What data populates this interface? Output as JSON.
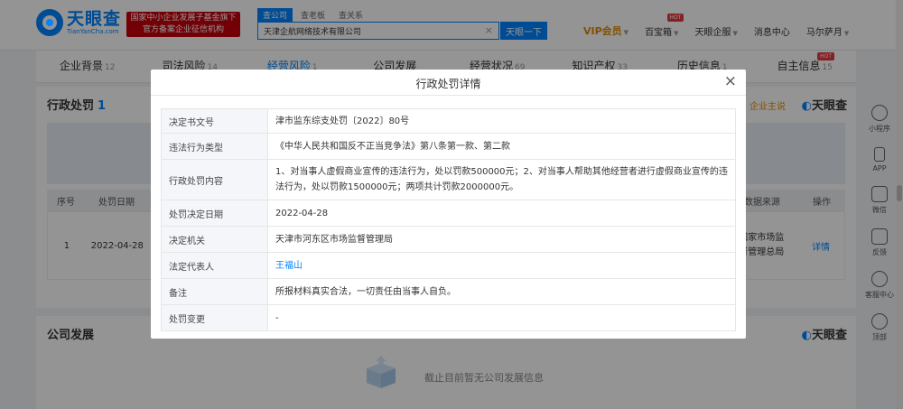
{
  "header": {
    "logo_cn": "天眼查",
    "logo_en": "TianYanCha.com",
    "gov_badge_line1": "国家中小企业发展子基金旗下",
    "gov_badge_line2": "官方备案企业征信机构",
    "search_tabs": [
      "查公司",
      "查老板",
      "查关系"
    ],
    "search_value": "天津企航网络技术有限公司",
    "search_button": "天眼一下",
    "nav": {
      "vip": "VIP会员",
      "treasure": "百宝箱",
      "hot": "HOT",
      "service": "天眼企服",
      "messages": "消息中心",
      "user": "马尔萨月"
    }
  },
  "tabs": [
    {
      "label": "企业背景",
      "count": "12"
    },
    {
      "label": "司法风险",
      "count": "14"
    },
    {
      "label": "经营风险",
      "count": "1"
    },
    {
      "label": "公司发展",
      "count": ""
    },
    {
      "label": "经营状况",
      "count": "69"
    },
    {
      "label": "知识产权",
      "count": "33"
    },
    {
      "label": "历史信息",
      "count": "1"
    },
    {
      "label": "自主信息",
      "count": "15"
    }
  ],
  "section_penalty": {
    "title": "行政处罚",
    "count": "1",
    "link": "企业主说",
    "brand": "天眼查",
    "headers": [
      "序号",
      "处罚日期",
      "数据来源",
      "操作"
    ],
    "row": {
      "index": "1",
      "date": "2022-04-28",
      "source": "国家市场监督管理总局",
      "action": "详情"
    }
  },
  "section_dev": {
    "title": "公司发展",
    "brand": "天眼查",
    "empty": "截止目前暂无公司发展信息"
  },
  "rail": [
    "小程序",
    "APP",
    "微信",
    "反馈",
    "客服中心",
    "顶部"
  ],
  "modal": {
    "title": "行政处罚详情",
    "close": "×",
    "rows": [
      {
        "k": "决定书文号",
        "v": "津市监东综支处罚〔2022〕80号"
      },
      {
        "k": "违法行为类型",
        "v": "《中华人民共和国反不正当竞争法》第八条第一款、第二款"
      },
      {
        "k": "行政处罚内容",
        "v": "1、对当事人虚假商业宣传的违法行为，处以罚款500000元；2、对当事人帮助其他经营者进行虚假商业宣传的违法行为，处以罚款1500000元；两项共计罚款2000000元。"
      },
      {
        "k": "处罚决定日期",
        "v": "2022-04-28"
      },
      {
        "k": "决定机关",
        "v": "天津市河东区市场监督管理局"
      },
      {
        "k": "法定代表人",
        "v": "王福山"
      },
      {
        "k": "备注",
        "v": "所报材料真实合法，一切责任由当事人自负。"
      },
      {
        "k": "处罚变更",
        "v": "-"
      }
    ]
  }
}
